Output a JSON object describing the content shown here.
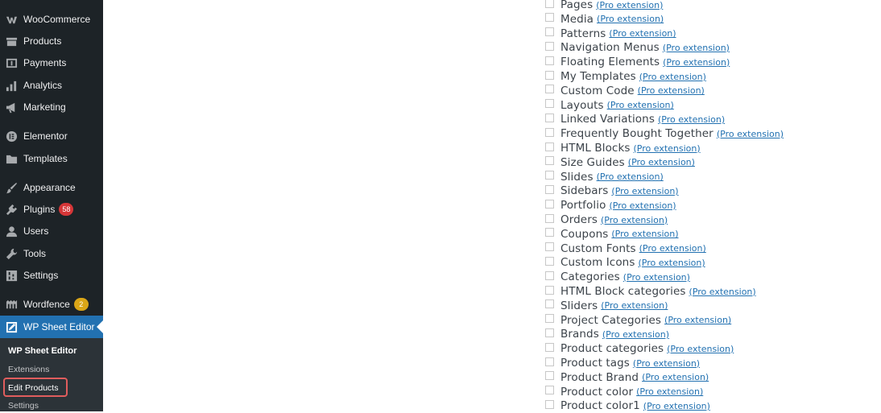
{
  "sidebar": {
    "items": [
      {
        "label": "WooCommerce",
        "icon": "woocommerce-icon"
      },
      {
        "label": "Products",
        "icon": "products-icon"
      },
      {
        "label": "Payments",
        "icon": "payments-icon"
      },
      {
        "label": "Analytics",
        "icon": "analytics-icon"
      },
      {
        "label": "Marketing",
        "icon": "megaphone-icon"
      },
      {
        "label": "Elementor",
        "icon": "elementor-icon"
      },
      {
        "label": "Templates",
        "icon": "folder-icon"
      },
      {
        "label": "Appearance",
        "icon": "brush-icon"
      },
      {
        "label": "Plugins",
        "icon": "plugin-icon",
        "badge": "58"
      },
      {
        "label": "Users",
        "icon": "user-icon"
      },
      {
        "label": "Tools",
        "icon": "wrench-icon"
      },
      {
        "label": "Settings",
        "icon": "settings-icon"
      },
      {
        "label": "Wordfence",
        "icon": "wordfence-icon",
        "badge": "2"
      },
      {
        "label": "WP Sheet Editor",
        "icon": "sheet-editor-icon"
      }
    ],
    "submenu": {
      "title": "WP Sheet Editor",
      "items": [
        "Extensions",
        "Edit Products",
        "Settings"
      ]
    }
  },
  "pro_link_text": "(Pro extension)",
  "checklist": [
    "Pages",
    "Media",
    "Patterns",
    "Navigation Menus",
    "Floating Elements",
    "My Templates",
    "Custom Code",
    "Layouts",
    "Linked Variations",
    "Frequently Bought Together",
    "HTML Blocks",
    "Size Guides",
    "Slides",
    "Sidebars",
    "Portfolio",
    "Orders",
    "Coupons",
    "Custom Fonts",
    "Custom Icons",
    "Categories",
    "HTML Block categories",
    "Sliders",
    "Project Categories",
    "Brands",
    "Product categories",
    "Product tags",
    "Product Brand",
    "Product color",
    "Product color1"
  ],
  "colors": {
    "sidebar_bg": "#1d2327",
    "current_bg": "#2271b1",
    "badge_red": "#d63638",
    "badge_yellow": "#dba617",
    "link": "#2271b1",
    "highlight": "#e05d5d"
  }
}
